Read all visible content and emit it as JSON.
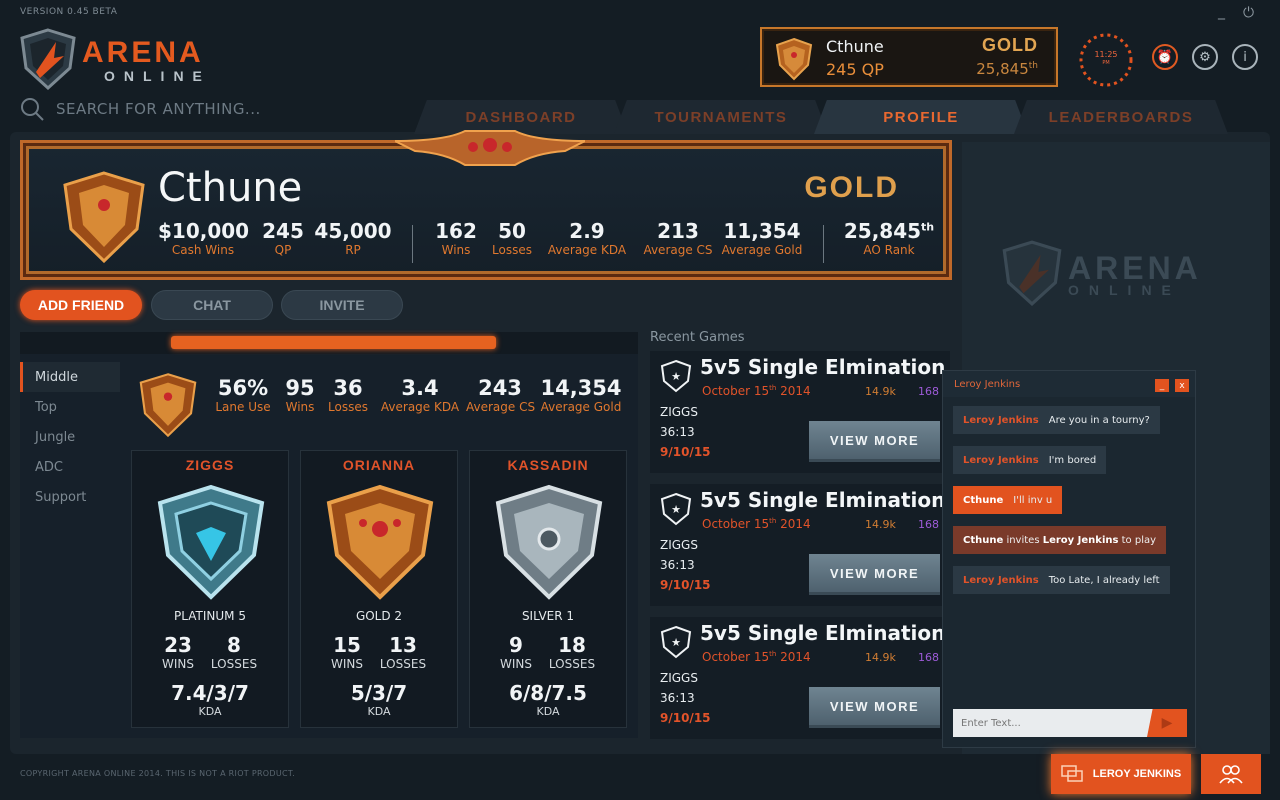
{
  "app": {
    "version": "VERSION 0.45 BETA",
    "logo_top": "ARENA",
    "logo_bottom": "ONLINE",
    "copyright": "COPYRIGHT ARENA ONLINE 2014. THIS IS NOT A RIOT PRODUCT."
  },
  "search": {
    "placeholder": "SEARCH FOR ANYTHING..."
  },
  "user": {
    "name": "Cthune",
    "qp": "245 QP",
    "tier": "GOLD",
    "rank": "25,845",
    "rank_suffix": "th"
  },
  "clock": {
    "time": "11:25",
    "ampm": "PM"
  },
  "tabs": [
    {
      "label": "DASHBOARD",
      "active": false
    },
    {
      "label": "TOURNAMENTS",
      "active": false
    },
    {
      "label": "PROFILE",
      "active": true
    },
    {
      "label": "LEADERBOARDS",
      "active": false
    }
  ],
  "profile": {
    "name": "Cthune",
    "tier": "GOLD",
    "stats": [
      {
        "value": "$10,000",
        "label": "Cash Wins"
      },
      {
        "value": "245",
        "label": "QP"
      },
      {
        "value": "45,000",
        "label": "RP"
      },
      {
        "value": "162",
        "label": "Wins"
      },
      {
        "value": "50",
        "label": "Losses"
      },
      {
        "value": "2.9",
        "label": "Average KDA"
      },
      {
        "value": "213",
        "label": "Average CS"
      },
      {
        "value": "11,354",
        "label": "Average Gold"
      },
      {
        "value": "25,845",
        "sup": "th",
        "label": "AO Rank"
      }
    ]
  },
  "actions": {
    "add_friend": "ADD FRIEND",
    "chat": "CHAT",
    "invite": "INVITE"
  },
  "roles": {
    "items": [
      "Middle",
      "Top",
      "Jungle",
      "ADC",
      "Support"
    ],
    "active": "Middle",
    "lane_bar_fraction": 0.53,
    "stats": [
      {
        "value": "56%",
        "label": "Lane Use"
      },
      {
        "value": "95",
        "label": "Wins"
      },
      {
        "value": "36",
        "label": "Losses"
      },
      {
        "value": "3.4",
        "label": "Average KDA"
      },
      {
        "value": "243",
        "label": "Average CS"
      },
      {
        "value": "14,354",
        "label": "Average Gold"
      }
    ]
  },
  "champions": [
    {
      "name": "ZIGGS",
      "rank": "PLATINUM 5",
      "wins": "23",
      "losses": "8",
      "kda": "7.4/3/7",
      "badge": "platinum"
    },
    {
      "name": "ORIANNA",
      "rank": "GOLD 2",
      "wins": "15",
      "losses": "13",
      "kda": "5/3/7",
      "badge": "gold"
    },
    {
      "name": "KASSADIN",
      "rank": "SILVER 1",
      "wins": "9",
      "losses": "18",
      "kda": "6/8/7.5",
      "badge": "silver"
    }
  ],
  "labels": {
    "wins": "WINS",
    "losses": "LOSSES",
    "kda": "KDA"
  },
  "recent": {
    "title": "Recent Games",
    "games": [
      {
        "title": "5v5 Single Elmination",
        "date": "October 15",
        "date_suffix": "th",
        "year": " 2014",
        "views": "14.9k",
        "num": "168",
        "champ": "ZIGGS",
        "time": "36:13",
        "day": "9/10/15",
        "button": "VIEW MORE"
      },
      {
        "title": "5v5 Single Elmination",
        "date": "October 15",
        "date_suffix": "th",
        "year": " 2014",
        "views": "14.9k",
        "num": "168",
        "champ": "ZIGGS",
        "time": "36:13",
        "day": "9/10/15",
        "button": "VIEW MORE"
      },
      {
        "title": "5v5 Single Elmination",
        "date": "October 15",
        "date_suffix": "th",
        "year": " 2014",
        "views": "14.9k",
        "num": "168",
        "champ": "ZIGGS",
        "time": "36:13",
        "day": "9/10/15",
        "button": "VIEW MORE"
      }
    ]
  },
  "chat": {
    "title": "Leroy Jenkins",
    "minimize": "_",
    "close": "x",
    "messages": [
      {
        "who": "Leroy Jenkins",
        "text": "Are you in a tourny?",
        "type": "other"
      },
      {
        "who": "Leroy Jenkins",
        "text": "I'm bored",
        "type": "other"
      },
      {
        "who": "Cthune",
        "text": "I'll inv u",
        "type": "mine"
      },
      {
        "who": "Cthune",
        "text": " invites ",
        "target": "Leroy Jenkins",
        "tail": " to play",
        "type": "invite"
      },
      {
        "who": "Leroy Jenkins",
        "text": "Too Late, I already left",
        "type": "other"
      }
    ],
    "input_placeholder": "Enter Text..."
  },
  "bottom": {
    "chat_button": "LEROY JENKINS"
  },
  "colors": {
    "accent": "#e2531f",
    "gold": "#e0a04d",
    "background": "#141d24"
  }
}
